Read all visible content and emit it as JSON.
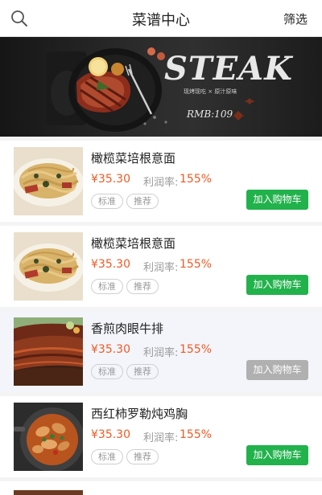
{
  "header": {
    "title": "菜谱中心",
    "filter_label": "筛选",
    "search_icon": "search-icon"
  },
  "banner": {
    "title": "STEAK",
    "subtitle": "现烤现吃 × 原汁原味",
    "price": "RMB:109"
  },
  "items": [
    {
      "name": "橄榄菜培根意面",
      "price": "¥35.30",
      "profit_label": "利润率:",
      "profit_value": "155%",
      "tags": [
        "标准",
        "推荐"
      ],
      "cart_label": "加入购物车",
      "cart_enabled": true,
      "highlighted": false,
      "image": "pasta"
    },
    {
      "name": "橄榄菜培根意面",
      "price": "¥35.30",
      "profit_label": "利润率:",
      "profit_value": "155%",
      "tags": [
        "标准",
        "推荐"
      ],
      "cart_label": "加入购物车",
      "cart_enabled": true,
      "highlighted": false,
      "image": "pasta"
    },
    {
      "name": "香煎肉眼牛排",
      "price": "¥35.30",
      "profit_label": "利润率:",
      "profit_value": "155%",
      "tags": [
        "标准",
        "推荐"
      ],
      "cart_label": "加入购物车",
      "cart_enabled": false,
      "highlighted": true,
      "image": "steak"
    },
    {
      "name": "西红柿罗勒炖鸡胸",
      "price": "¥35.30",
      "profit_label": "利润率:",
      "profit_value": "155%",
      "tags": [
        "标准",
        "推荐"
      ],
      "cart_label": "加入购物车",
      "cart_enabled": true,
      "highlighted": false,
      "image": "chicken"
    }
  ],
  "colors": {
    "accent_price": "#f05a24",
    "cart_green": "#22b24c",
    "cart_disabled": "#b0b0b0"
  }
}
